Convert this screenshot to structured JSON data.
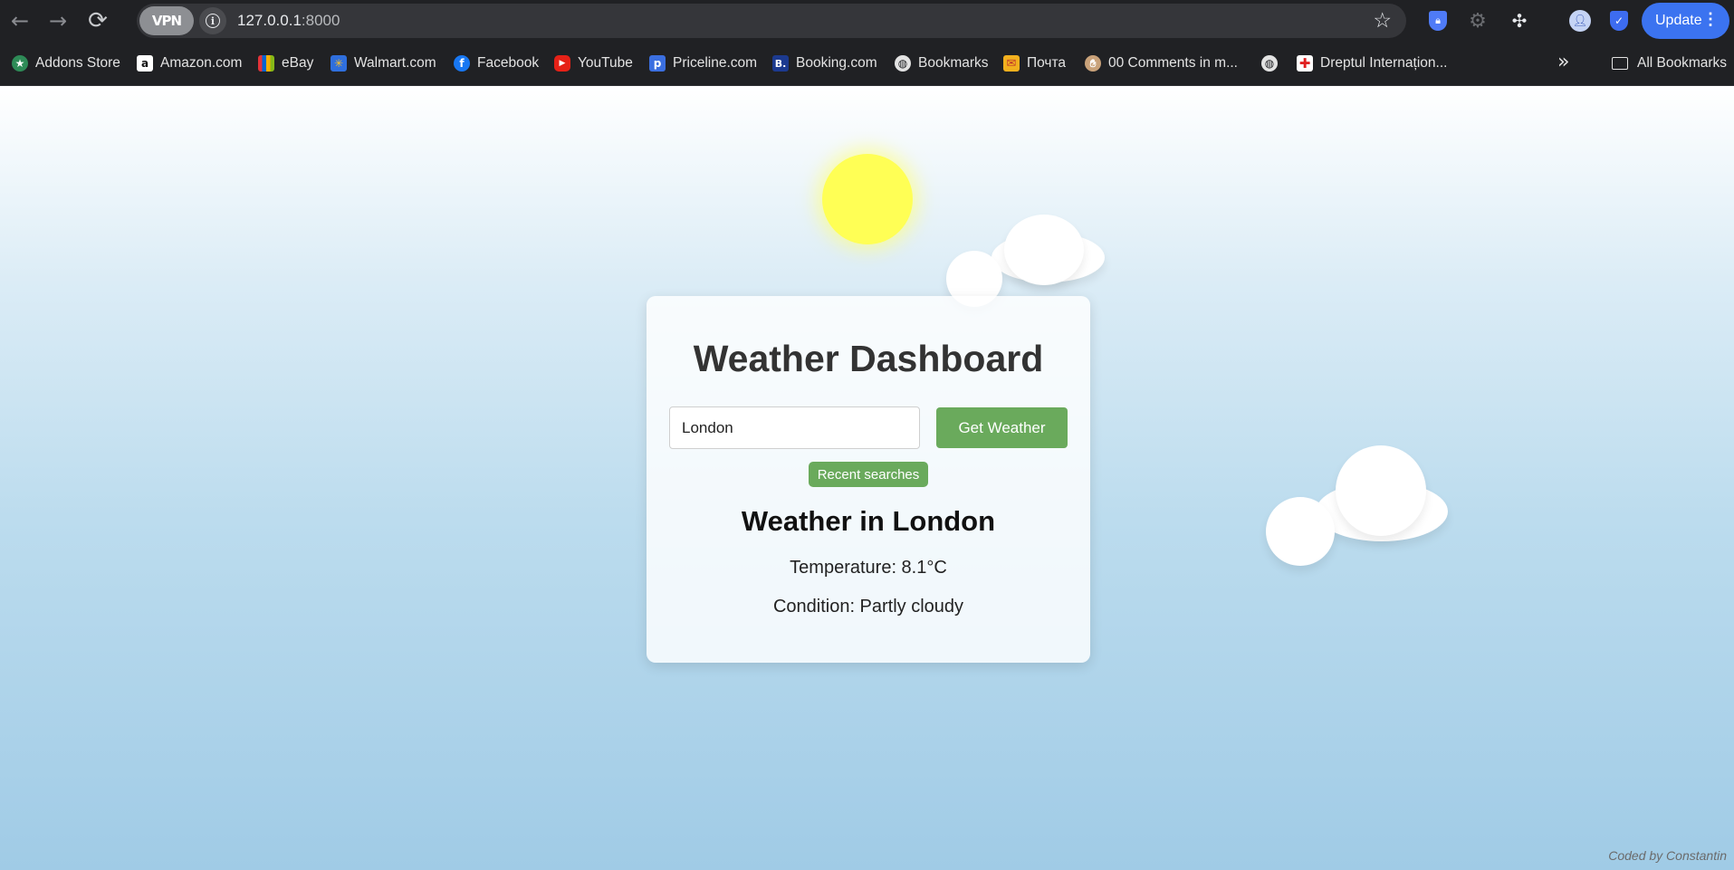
{
  "browser": {
    "url_host": "127.0.0.1",
    "url_port": ":8000",
    "vpn_label": "VPN",
    "update_label": "Update"
  },
  "bookmarks": [
    {
      "label": "Addons Store",
      "icon": "addons-store-icon",
      "color": "#2e8b57"
    },
    {
      "label": "Amazon.com",
      "icon": "amazon-icon",
      "color": "#ffffff"
    },
    {
      "label": "eBay",
      "icon": "ebay-icon",
      "color": "#e53238"
    },
    {
      "label": "Walmart.com",
      "icon": "walmart-icon",
      "color": "#2f6fdd"
    },
    {
      "label": "Facebook",
      "icon": "facebook-icon",
      "color": "#1877f2"
    },
    {
      "label": "YouTube",
      "icon": "youtube-icon",
      "color": "#e62117"
    },
    {
      "label": "Priceline.com",
      "icon": "priceline-icon",
      "color": "#3b6fe0"
    },
    {
      "label": "Booking.com",
      "icon": "booking-icon",
      "color": "#1c3a8f"
    },
    {
      "label": "Bookmarks",
      "icon": "globe-icon",
      "color": "#5f6368"
    },
    {
      "label": "Почта",
      "icon": "mail-icon",
      "color": "#f2b01e"
    },
    {
      "label": "00 Comments in m...",
      "icon": "hand-icon",
      "color": "#c9a27a"
    },
    {
      "label": "",
      "icon": "globe-icon",
      "color": "#5f6368"
    },
    {
      "label": "Dreptul Internațion...",
      "icon": "red-cross-icon",
      "color": "#ffffff"
    }
  ],
  "all_bookmarks_label": "All Bookmarks",
  "app": {
    "title": "Weather Dashboard",
    "city_value": "London",
    "get_weather_label": "Get Weather",
    "recent_label": "Recent searches",
    "weather_heading": "Weather in London",
    "temperature_text": "Temperature: 8.1°C",
    "condition_text": "Condition: Partly cloudy",
    "credit": "Coded by Constantin"
  },
  "colors": {
    "accent_green": "#6aaa5c",
    "sun": "#ffff55",
    "update_blue": "#3b73f0"
  }
}
